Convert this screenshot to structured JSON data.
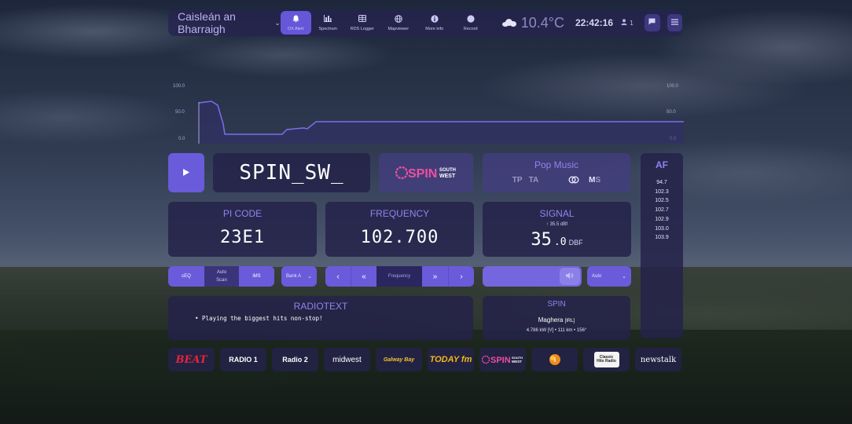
{
  "header": {
    "station_name": "Caisleán an Bharraigh",
    "nav": [
      {
        "label": "DX Alert",
        "icon": "bell-icon",
        "active": true
      },
      {
        "label": "Spectrum",
        "icon": "chart-icon",
        "active": false
      },
      {
        "label": "RDS Logger",
        "icon": "table-icon",
        "active": false
      },
      {
        "label": "Mapviewer",
        "icon": "globe-icon",
        "active": false
      },
      {
        "label": "More info",
        "icon": "info-icon",
        "active": false
      },
      {
        "label": "Record",
        "icon": "record-icon",
        "active": false
      }
    ],
    "temperature": "10.4°C",
    "time": "22:42:16",
    "users": "1"
  },
  "graph": {
    "y_ticks": [
      "100.0",
      "50.0",
      "0.0"
    ]
  },
  "tuner": {
    "ps": "SPIN_SW_",
    "station_logo": {
      "part1": "SPIN",
      "part2a": "SOUTH",
      "part2b": "WEST"
    },
    "pty": "Pop Music",
    "tp": "TP",
    "ta": "TA",
    "ms": "M",
    "ms_s": "S",
    "pi": {
      "title": "PI CODE",
      "value": "23E1"
    },
    "frequency": {
      "title": "FREQUENCY",
      "value": "102.700"
    },
    "signal": {
      "title": "SIGNAL",
      "peak": "35.5 dBf",
      "value": "35",
      "decimal": ".0",
      "unit": "DBF"
    }
  },
  "af": {
    "title": "AF",
    "items": [
      "94.7",
      "102.3",
      "102.5",
      "102.7",
      "102.9",
      "103.0",
      "103.9"
    ]
  },
  "controls": {
    "ceq": "cEQ",
    "auto_scan_1": "Auto",
    "auto_scan_2": "Scan",
    "ims": "iMS",
    "bank": "Bank A",
    "frequency_placeholder": "Frequency",
    "antenna": "Auto",
    "volume_level_percent": 100
  },
  "radiotext": {
    "title": "RADIOTEXT",
    "line": "• Playing the biggest hits non-stop!"
  },
  "transmitter": {
    "name": "SPIN",
    "location": "Maghera",
    "itu": "[IRL]",
    "details": "4.786 kW [V] • 111 km • 156°"
  },
  "presets": [
    {
      "name": "Beat",
      "text": "BEAT",
      "color": "#e8243c"
    },
    {
      "name": "RTE Radio 1",
      "text": "RADIO 1",
      "color": "#ffffff"
    },
    {
      "name": "RTE Radio 2",
      "text": "Radio 2",
      "color": "#ffffff"
    },
    {
      "name": "Midwest Radio",
      "text": "midwest",
      "color": "#ffffff"
    },
    {
      "name": "Galway Bay FM",
      "text": "Galway Bay",
      "color": "#f2c230"
    },
    {
      "name": "Today FM",
      "text": "TODAY fm",
      "color": "#f2b81a"
    },
    {
      "name": "Spin South West",
      "text": "SPIN",
      "color": "#ef4fa0"
    },
    {
      "name": "iRadio",
      "text": "i",
      "color": "#f08a1d"
    },
    {
      "name": "Classic Hits Radio",
      "text": "Classic Hits Radio",
      "color": "#222222"
    },
    {
      "name": "Newstalk",
      "text": "newstalk",
      "color": "#ffffff"
    }
  ],
  "colors": {
    "accent": "#6a5bdb",
    "title": "#8f84ee",
    "panel": "#24224a"
  }
}
